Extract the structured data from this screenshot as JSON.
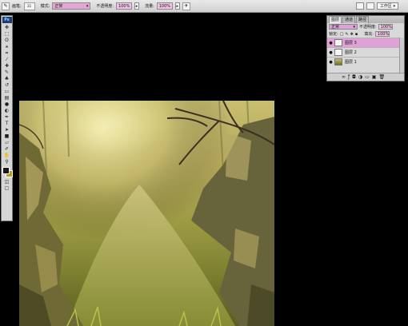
{
  "options_bar": {
    "brush_label": "画笔:",
    "brush_size": "21",
    "mode_label": "模式:",
    "mode_value": "正常",
    "opacity_label": "不透明度:",
    "opacity_value": "100%",
    "flow_label": "流量:",
    "flow_value": "100%",
    "workspace_label": "工作区"
  },
  "toolbox": {
    "logo": "Ps",
    "tools": [
      "move-icon",
      "marquee-icon",
      "lasso-icon",
      "magic-wand-icon",
      "crop-icon",
      "slice-icon",
      "healing-brush-icon",
      "brush-icon",
      "clone-stamp-icon",
      "history-brush-icon",
      "eraser-icon",
      "gradient-icon",
      "blur-icon",
      "dodge-icon",
      "pen-icon",
      "type-icon",
      "path-select-icon",
      "shape-icon",
      "notes-icon",
      "eyedropper-icon",
      "hand-icon",
      "zoom-icon"
    ],
    "colors": {
      "foreground": "#1a1a1a",
      "background": "#b89a22"
    }
  },
  "layers_panel": {
    "tabs": [
      "图层",
      "通道",
      "路径"
    ],
    "mode_value": "正常",
    "opacity_label": "不透明度:",
    "opacity_value": "100%",
    "lock_label": "锁定:",
    "fill_label": "填充:",
    "fill_value": "100%",
    "layers": [
      {
        "name": "图层 3",
        "selected": true
      },
      {
        "name": "图层 2",
        "selected": false
      },
      {
        "name": "图层 1",
        "selected": false
      }
    ]
  },
  "colors": {
    "selection_pink": "#e0a2d6",
    "canvas_highlight": "#ece7a6",
    "canvas_shadow": "#5b5d22"
  }
}
